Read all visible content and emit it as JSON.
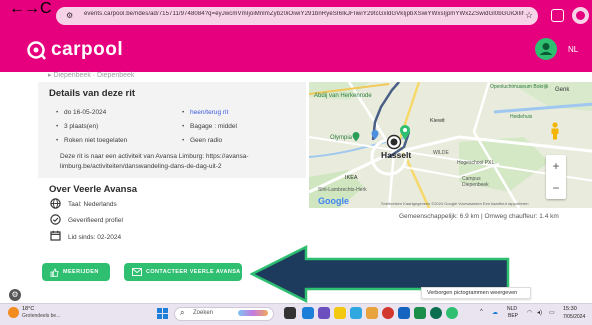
{
  "browser": {
    "url": "events.carpool.be/rides/ad/715711/9748084?q=eyJwcmVmIjoiMnlmZyb20iOiwiY291bnRyeSI6IkJFIiwiY29tcGxldGVkIjpbXSwiYWxsIjpmYWxzZSwidGl0bGUiOiIifQ...",
    "nav_back": "←",
    "nav_forward": "→",
    "nav_reload": "C",
    "star": "☆"
  },
  "header": {
    "logo_text": "carpool",
    "lang": "NL"
  },
  "page": {
    "cut_line": "▸ Diepenbeek · Diepenbeek"
  },
  "details": {
    "title": "Details van deze rit",
    "left_items": [
      "do 16-05-2024",
      "3 plaats(en)",
      "Roken niet toegelaten"
    ],
    "right_items": [
      "heen/terug rit",
      "Bagage : middel",
      "Geen radio"
    ],
    "description": "Deze rit is naar een activiteit van Avansa Limburg: https://avansa-limburg.be/activiteiten/danswandeling-dans-de-dag-uit-2"
  },
  "about": {
    "title": "Over Veerle Avansa",
    "items": [
      {
        "icon": "globe-icon",
        "text": "Taal: Nederlands"
      },
      {
        "icon": "check-circle-icon",
        "text": "Geverifieerd profiel"
      },
      {
        "icon": "calendar-icon",
        "text": "Lid sinds: 02-2024"
      }
    ]
  },
  "buttons": {
    "share": "MEERIJDEN",
    "contact": "CONTACTEER VEERLE AVANSA"
  },
  "map": {
    "labels": {
      "abdij": "Abdij van Herkenrode",
      "olympia": "Olympia",
      "hasselt": "Hasselt",
      "wilde": "WILDE",
      "hogeschool": "Hogeschool PXL",
      "campus": "Campus Diepenbeek",
      "ikea": "IKEA",
      "openluchtmuseum": "Openluchtmuseum Bokrijk",
      "kiewit": "Kiewit",
      "heidehuis": "Heidehuis",
      "sint_lambrechts": "Sint-Lambrechts-Herk",
      "genk": "Genk"
    },
    "footer": "Sneltoetsen  Kaartgegevens ©2024 Google  Voorwaarden  Een kaartfout rapporteren",
    "google": "Google",
    "route_text": "Gemeenschappelijk: 6.9 km | Omweg chauffeur: 1.4 km"
  },
  "tooltip": "Verborgen pictogrammen weergeven",
  "taskbar": {
    "weather_temp": "18°C",
    "weather_desc": "Grotendeels be...",
    "search": "Zoeken",
    "lang_top": "NLD",
    "lang_bottom": "BEP",
    "time": "15:30",
    "date": "7/05/2024"
  },
  "colors": {
    "brand": "#e6007e",
    "button_green": "#2fbf71",
    "arrow_navy": "#1d3b5c",
    "arrow_outline": "#2fbf71"
  }
}
